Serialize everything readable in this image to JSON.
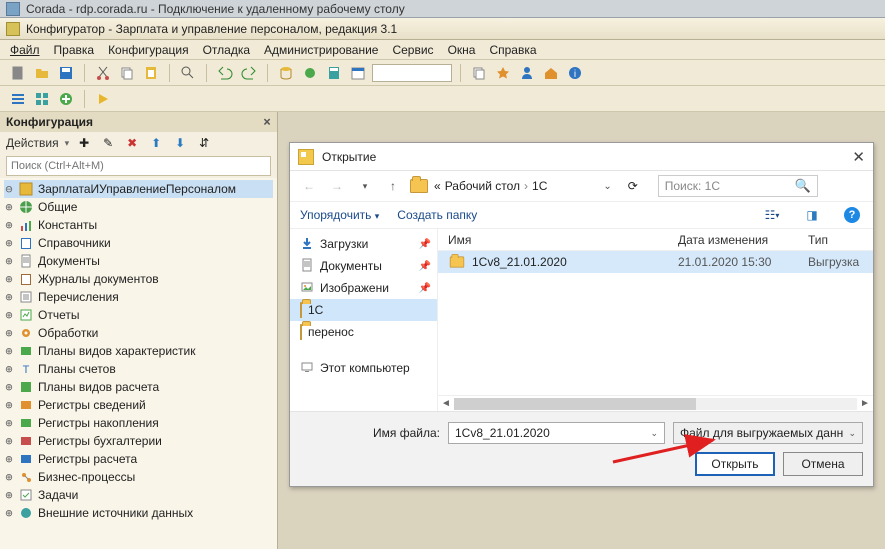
{
  "window": {
    "outer_title": "Corada - rdp.corada.ru - Подключение к удаленному рабочему столу",
    "app_title": "Конфигуратор - Зарплата и управление персоналом, редакция 3.1"
  },
  "menu": {
    "file": "Файл",
    "edit": "Правка",
    "config": "Конфигурация",
    "debug": "Отладка",
    "admin": "Администрирование",
    "service": "Сервис",
    "windows": "Окна",
    "help": "Справка"
  },
  "panel": {
    "title": "Конфигурация",
    "actions": "Действия",
    "search_placeholder": "Поиск (Ctrl+Alt+M)"
  },
  "tree": [
    {
      "label": "ЗарплатаИУправлениеПерсоналом",
      "icon": "cube-yellow",
      "sel": true
    },
    {
      "label": "Общие",
      "icon": "globe"
    },
    {
      "label": "Константы",
      "icon": "bars"
    },
    {
      "label": "Справочники",
      "icon": "book-blue"
    },
    {
      "label": "Документы",
      "icon": "doc"
    },
    {
      "label": "Журналы документов",
      "icon": "book-brown"
    },
    {
      "label": "Перечисления",
      "icon": "list"
    },
    {
      "label": "Отчеты",
      "icon": "report"
    },
    {
      "label": "Обработки",
      "icon": "gear"
    },
    {
      "label": "Планы видов характеристик",
      "icon": "chars"
    },
    {
      "label": "Планы счетов",
      "icon": "accounts"
    },
    {
      "label": "Планы видов расчета",
      "icon": "calc"
    },
    {
      "label": "Регистры сведений",
      "icon": "reg-info"
    },
    {
      "label": "Регистры накопления",
      "icon": "reg-acc"
    },
    {
      "label": "Регистры бухгалтерии",
      "icon": "reg-book"
    },
    {
      "label": "Регистры расчета",
      "icon": "reg-calc"
    },
    {
      "label": "Бизнес-процессы",
      "icon": "biz"
    },
    {
      "label": "Задачи",
      "icon": "task"
    },
    {
      "label": "Внешние источники данных",
      "icon": "ext"
    }
  ],
  "dialog": {
    "title": "Открытие",
    "breadcrumb": {
      "prefix": "«",
      "a": "Рабочий стол",
      "b": "1C"
    },
    "search_placeholder": "Поиск: 1C",
    "organize": "Упорядочить",
    "new_folder": "Создать папку",
    "cols": {
      "name": "Имя",
      "date": "Дата изменения",
      "type": "Тип"
    },
    "nav": [
      {
        "label": "Загрузки",
        "icon": "download",
        "pin": true
      },
      {
        "label": "Документы",
        "icon": "doc",
        "pin": true
      },
      {
        "label": "Изображени",
        "icon": "image",
        "pin": true
      },
      {
        "label": "1C",
        "icon": "folder",
        "sel": true
      },
      {
        "label": "перенос",
        "icon": "folder"
      },
      {
        "label": "Этот компьютер",
        "icon": "pc"
      }
    ],
    "files": [
      {
        "name": "1Cv8_21.01.2020",
        "date": "21.01.2020 15:30",
        "type": "Выгрузка",
        "sel": true
      }
    ],
    "filename_label": "Имя файла:",
    "filename_value": "1Cv8_21.01.2020",
    "filetype": "Файл для выгружаемых данн",
    "btn_open": "Открыть",
    "btn_cancel": "Отмена"
  }
}
